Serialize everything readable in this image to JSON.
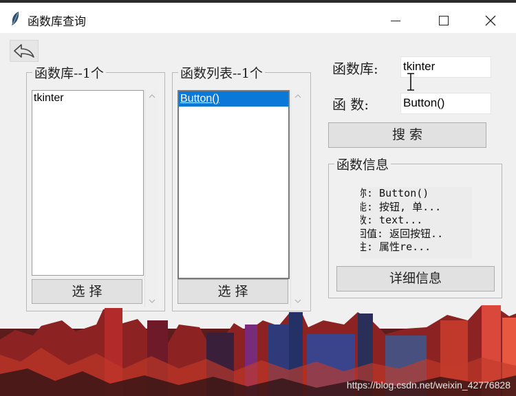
{
  "window": {
    "title": "函数库查询",
    "icon": "feather-icon"
  },
  "library_group": {
    "title": "函数库--1个",
    "items": [
      "tkinter"
    ],
    "select_label": "选 择"
  },
  "function_group": {
    "title": "函数列表--1个",
    "items": [
      "Button()"
    ],
    "selected_index": 0,
    "select_label": "选 择"
  },
  "search": {
    "library_label": "函数库:",
    "library_value": "tkinter",
    "function_label": "函  数:",
    "function_value": "Button()",
    "search_label": "搜    索"
  },
  "info_group": {
    "title": "函数信息",
    "lines": [
      "称: Button()",
      "能: 按钮, 单...",
      "数: text...",
      "回值: 返回按钮..",
      "注: 属性re..."
    ],
    "detail_label": "详细信息"
  },
  "watermark": "https://blog.csdn.net/weixin_42776828",
  "colors": {
    "selection": "#0a78d7",
    "window_bg": "#f0f0f0"
  }
}
